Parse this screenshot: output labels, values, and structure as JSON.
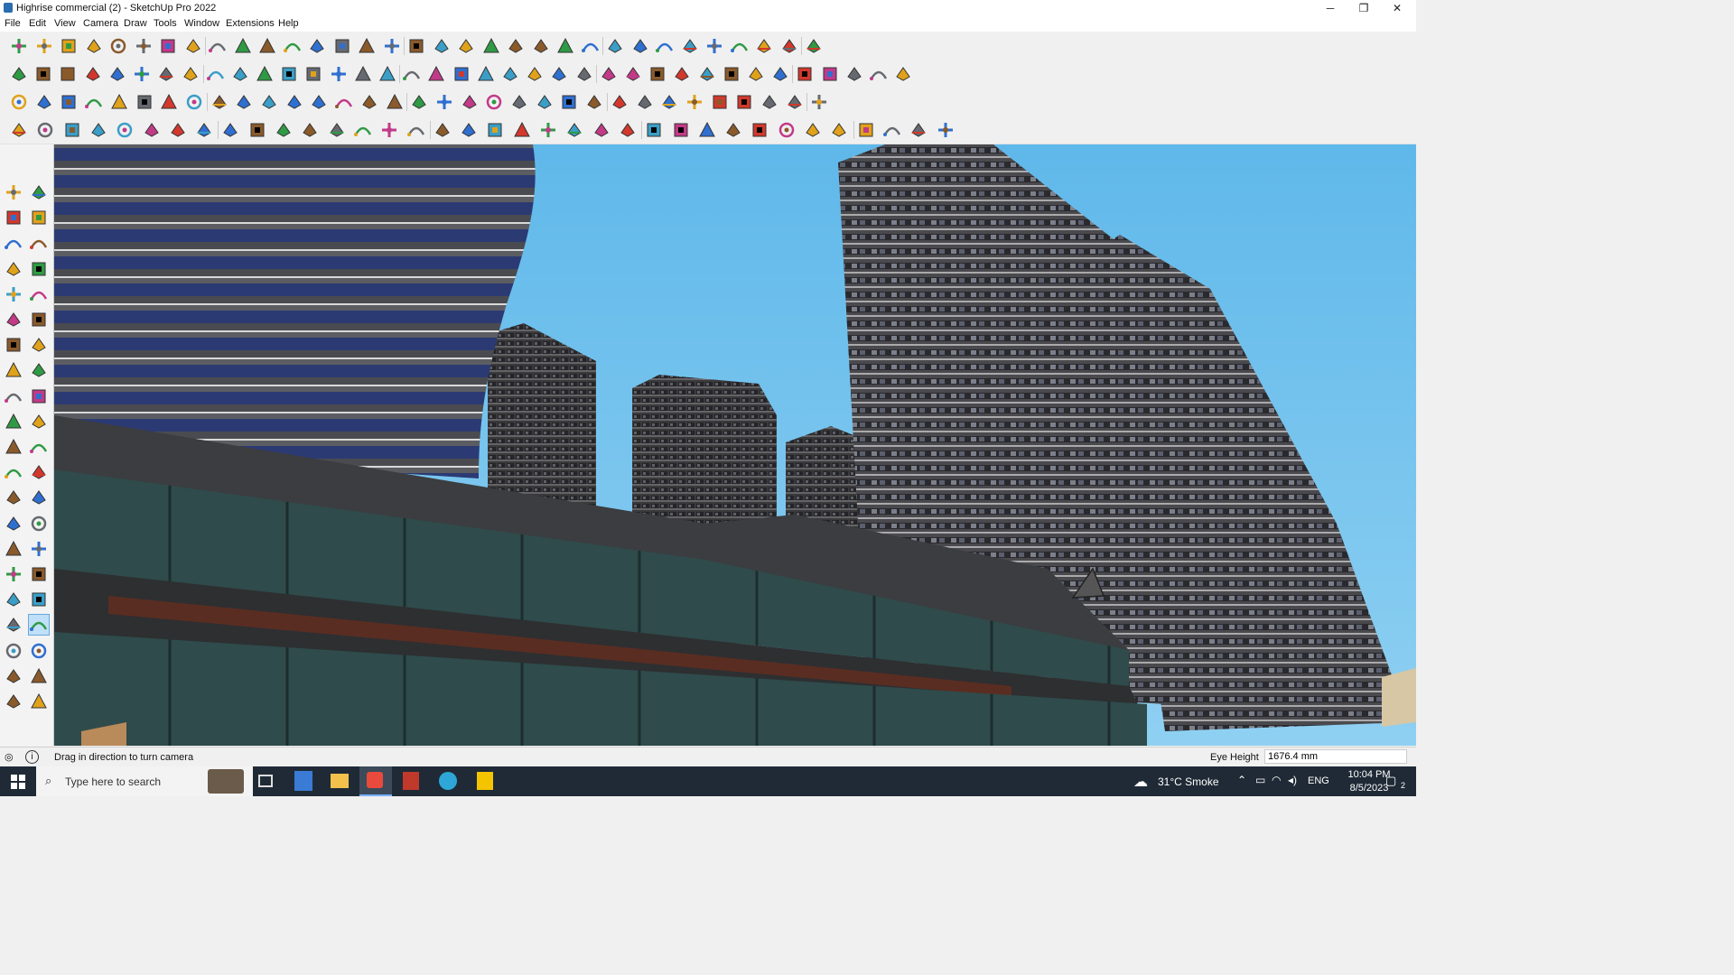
{
  "window": {
    "title": "Highrise commercial (2) - SketchUp Pro 2022",
    "minimize": "─",
    "restore": "❐",
    "close": "✕"
  },
  "menu": [
    "File",
    "Edit",
    "View",
    "Camera",
    "Draw",
    "Tools",
    "Window",
    "Extensions",
    "Help"
  ],
  "toolbars": {
    "row1": [
      "zoom-icon",
      "select-icon",
      "eraser-icon",
      "pencil-line-icon",
      "lasso-icon",
      "shape-icon",
      "push-pull-icon",
      "follow-me-icon",
      "move-icon",
      "rotate-icon",
      "scale-icon",
      "tape-measure-icon",
      "text-icon",
      "paint-bucket-icon",
      "orbit-icon",
      "pan-icon",
      "zoom-window-icon",
      "zoom-extents-icon",
      "section-plane-icon",
      "section-fill-icon",
      "layers-icon",
      "tag-icon",
      "user-icon",
      "component-icon",
      "material-icon",
      "axes-icon",
      "flip-icon",
      "mirror-icon",
      "move-axis-icon",
      "previous-view-icon",
      "undo-icon",
      "redo-icon",
      "warehouse-icon"
    ],
    "row2": [
      "cube-solid-icon",
      "cube-xray-icon",
      "cube-hidden-icon",
      "views-icon",
      "view-iso-icon",
      "view-top-icon",
      "view-front-icon",
      "view-right-icon",
      "view-back-icon",
      "view-left-icon",
      "view-bottom-icon",
      "curve-icon",
      "style-icon",
      "edge-icon",
      "profile-icon",
      "sandbox-icon",
      "smoove-icon",
      "house-icon",
      "house-2-icon",
      "home-icon",
      "garage-icon",
      "roof-icon",
      "terrain-icon",
      "fence-icon",
      "circle-icon",
      "ring-icon",
      "polygon-icon",
      "ellipse-icon",
      "parallelogram-icon",
      "arc-icon",
      "pie-icon",
      "pin-icon",
      "measure-icon",
      "line-style-icon",
      "solid-tools-icon",
      "geo-icon",
      "export-icon"
    ],
    "row3": [
      "plane-icon",
      "face-icon",
      "extrude-icon",
      "offset-icon",
      "flatten-icon",
      "stitch-icon",
      "curve-tool-icon",
      "red-box-icon",
      "slice-icon",
      "frame-icon",
      "beam-icon",
      "corner-icon",
      "path-icon",
      "cross-icon",
      "plus-icon",
      "star-icon",
      "cone-icon",
      "vase-icon",
      "triangle-icon",
      "horseshoe-icon",
      "spiral-icon",
      "twist-icon",
      "anchor-icon",
      "magnet-icon",
      "tree-icon",
      "array-icon",
      "copy-icon",
      "panel-icon",
      "grid-icon",
      "tile-icon",
      "explode-icon",
      "chain-icon",
      "nodes-icon"
    ],
    "row4": [
      "vertex-icon",
      "spline-icon",
      "truck-icon",
      "scissors-icon",
      "gear-icon",
      "wireframe-icon",
      "ribbon-icon",
      "sphere-icon",
      "globe-icon",
      "stairs-icon",
      "line-join-icon",
      "fillet-icon",
      "line-cut-icon",
      "arc-tool-icon",
      "window-icon",
      "roof-tool-icon",
      "rail-icon",
      "mesh-icon",
      "hand-icon",
      "leaf-icon",
      "angle-icon",
      "slats-icon",
      "hatch-icon",
      "beam-tool-icon",
      "truss-icon",
      "frame-tool-icon",
      "block-icon",
      "ramp-icon",
      "door-icon",
      "bars-icon",
      "cage-icon",
      "fence-tool-icon",
      "spiral-tool-icon",
      "wave-icon",
      "comb-icon",
      "house-tool-icon"
    ]
  },
  "left_tools": [
    "select-icon",
    "orbit-tool-icon",
    "paint-icon",
    "eraser-icon",
    "component-icon",
    "tape-icon",
    "line-icon",
    "freehand-icon",
    "rectangle-icon",
    "rotated-rect-icon",
    "circle-icon",
    "polygon-icon",
    "arc-icon",
    "pie-icon",
    "arc-3pt-icon",
    "arc-2pt-icon",
    "move-icon",
    "push-pull-icon",
    "rotate-icon",
    "follow-me-icon",
    "scale-icon",
    "offset-icon",
    "tape-measure-icon",
    "dimension-icon",
    "protractor-icon",
    "text-icon",
    "axes-icon",
    "3d-text-icon",
    "orbit-icon",
    "pan-icon",
    "zoom-icon",
    "zoom-window-icon",
    "zoom-extents-icon",
    "previous-icon",
    "position-camera-icon",
    "look-around-icon",
    "walk-icon",
    "section-icon",
    "section-display-icon",
    "section-cut-icon",
    "layers-icon",
    "layer-tool-icon"
  ],
  "status": {
    "hint": "Drag in direction to turn camera",
    "measure_label": "Eye Height",
    "measure_value": "1676.4 mm"
  },
  "taskbar": {
    "search_placeholder": "Type here to search",
    "weather": "31°C  Smoke",
    "lang": "ENG",
    "time": "10:04 PM",
    "date": "8/5/2023",
    "notifications": "2"
  }
}
